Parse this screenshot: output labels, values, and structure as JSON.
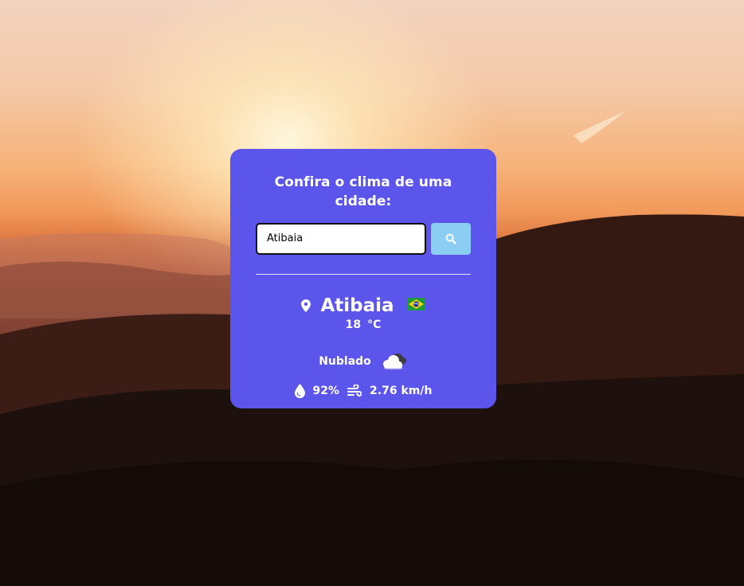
{
  "card": {
    "title": "Confira o clima de uma cidade:"
  },
  "search": {
    "value": "Atibaia",
    "button_icon": "search-icon"
  },
  "weather": {
    "city": "Atibaia",
    "country_flag": "brazil-flag-icon",
    "temperature": "18",
    "unit": "°C",
    "description": "Nublado",
    "condition_icon": "cloud-icon",
    "humidity": "92%",
    "wind": "2.76 km/h"
  },
  "colors": {
    "card_bg": "#5c55eb",
    "button_bg": "#8ccdf3",
    "text": "#ffffff"
  }
}
